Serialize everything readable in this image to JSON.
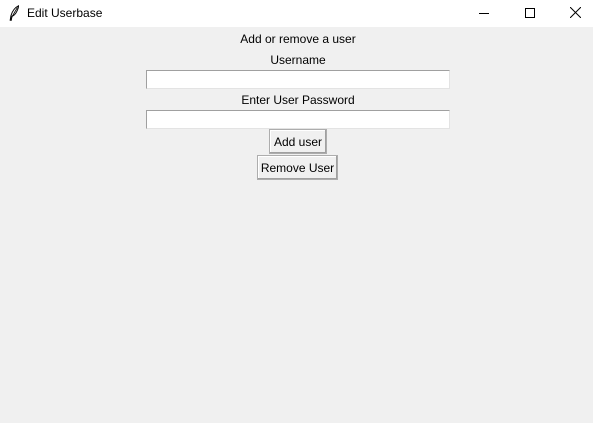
{
  "window": {
    "title": "Edit Userbase",
    "app_icon": "feather-icon",
    "controls": [
      "minimize-icon",
      "maximize-icon",
      "close-icon"
    ]
  },
  "form": {
    "header": "Add or remove a user",
    "username_label": "Username",
    "username_value": "",
    "password_label": "Enter User Password",
    "password_value": "",
    "add_button": "Add user",
    "remove_button": "Remove User"
  },
  "colors": {
    "background": "#f0f0f0",
    "titlebar": "#ffffff",
    "entry_background": "#ffffff",
    "text": "#000000"
  }
}
